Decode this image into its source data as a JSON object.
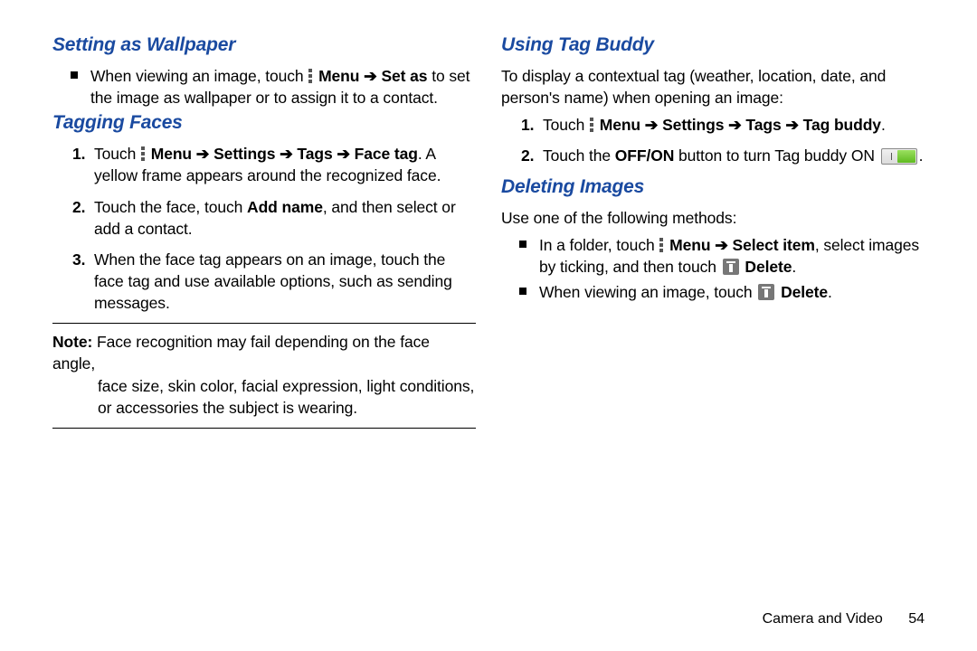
{
  "left": {
    "h1": "Setting as Wallpaper",
    "b1_a": "When viewing an image, touch ",
    "b1_menu": "Menu",
    "b1_setas": "Set as",
    "b1_b": " to set the image as wallpaper or to assign it to a contact.",
    "h2": "Tagging Faces",
    "s1_a": "Touch ",
    "s1_path": "Menu ➔ Settings ➔ Tags ➔ Face tag",
    "s1_b": ". A yellow frame appears around the recognized face.",
    "s2_a": "Touch the face, touch ",
    "s2_bold": "Add name",
    "s2_b": ", and then select or add a contact.",
    "s3": "When the face tag appears on an image, touch the face tag and use available options, such as sending messages.",
    "note_label": "Note:",
    "note_first": " Face recognition may fail depending on the face angle,",
    "note_rest": "face size, skin color, facial expression, light conditions, or accessories the subject is wearing."
  },
  "right": {
    "h1": "Using Tag Buddy",
    "p1": "To display a contextual tag (weather, location, date, and person's name) when opening an image:",
    "s1_a": "Touch ",
    "s1_path": "Menu ➔ Settings ➔ Tags ➔ Tag buddy",
    "s1_b": ".",
    "s2_a": "Touch the ",
    "s2_bold": "OFF/ON",
    "s2_b": " button to turn Tag buddy ON ",
    "s2_c": ".",
    "h2": "Deleting Images",
    "p2": "Use one of the following methods:",
    "b1_a": "In a folder, touch ",
    "b1_menu": "Menu",
    "b1_select": "Select item",
    "b1_b": ", select images by ticking, and then touch ",
    "b1_delete": "Delete",
    "b1_c": ".",
    "b2_a": "When viewing an image, touch ",
    "b2_delete": "Delete",
    "b2_b": "."
  },
  "footer": {
    "section": "Camera and Video",
    "page": "54"
  }
}
